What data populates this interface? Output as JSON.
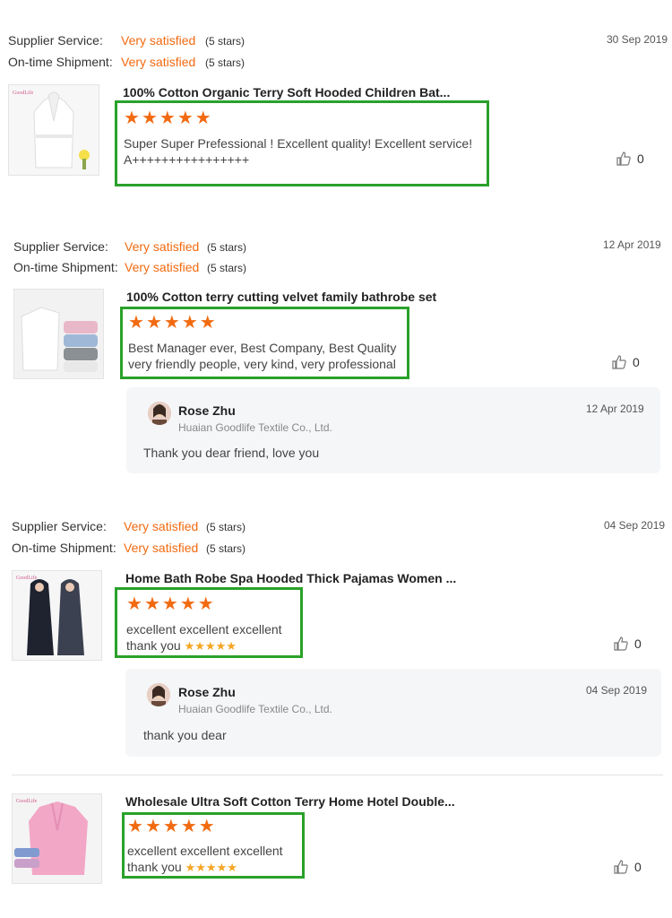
{
  "labels": {
    "supplier_service": "Supplier Service:",
    "ontime_shipment": "On-time Shipment:",
    "very_satisfied": "Very satisfied",
    "five_stars": "(5 stars)"
  },
  "colors": {
    "accent": "#f26a10",
    "highlight": "#2aa12a",
    "star": "#f26a10",
    "mini_star": "#f5a623"
  },
  "reviews": [
    {
      "date": "30 Sep 2019",
      "product_title": "100% Cotton Organic Terry Soft Hooded Children Bat...",
      "rating": 5,
      "comment_line1": "Super Super Prefessional ! Excellent quality! Excellent service!",
      "comment_line2": "A++++++++++++++++",
      "likes": "0"
    },
    {
      "date": "12 Apr 2019",
      "product_title": "100% Cotton terry cutting velvet family bathrobe set",
      "rating": 5,
      "comment_line1": "Best Manager ever, Best Company, Best Quality",
      "comment_line2": "very friendly people, very kind, very professional",
      "likes": "0",
      "reply": {
        "name": "Rose Zhu",
        "company": "Huaian Goodlife Textile Co., Ltd.",
        "date": "12 Apr 2019",
        "text": "Thank you dear friend, love you"
      }
    },
    {
      "date": "04 Sep 2019",
      "product_title": "Home Bath Robe Spa Hooded Thick Pajamas Women ...",
      "rating": 5,
      "comment_line1": "excellent excellent excellent",
      "comment_line2": "thank you",
      "likes": "0",
      "reply": {
        "name": "Rose Zhu",
        "company": "Huaian Goodlife Textile Co., Ltd.",
        "date": "04 Sep 2019",
        "text": "thank you dear"
      }
    },
    {
      "product_title": "Wholesale Ultra Soft Cotton Terry Home Hotel Double...",
      "rating": 5,
      "comment_line1": "excellent excellent excellent",
      "comment_line2": "thank you",
      "likes": "0"
    }
  ],
  "thumb_brand": "GoodLife"
}
